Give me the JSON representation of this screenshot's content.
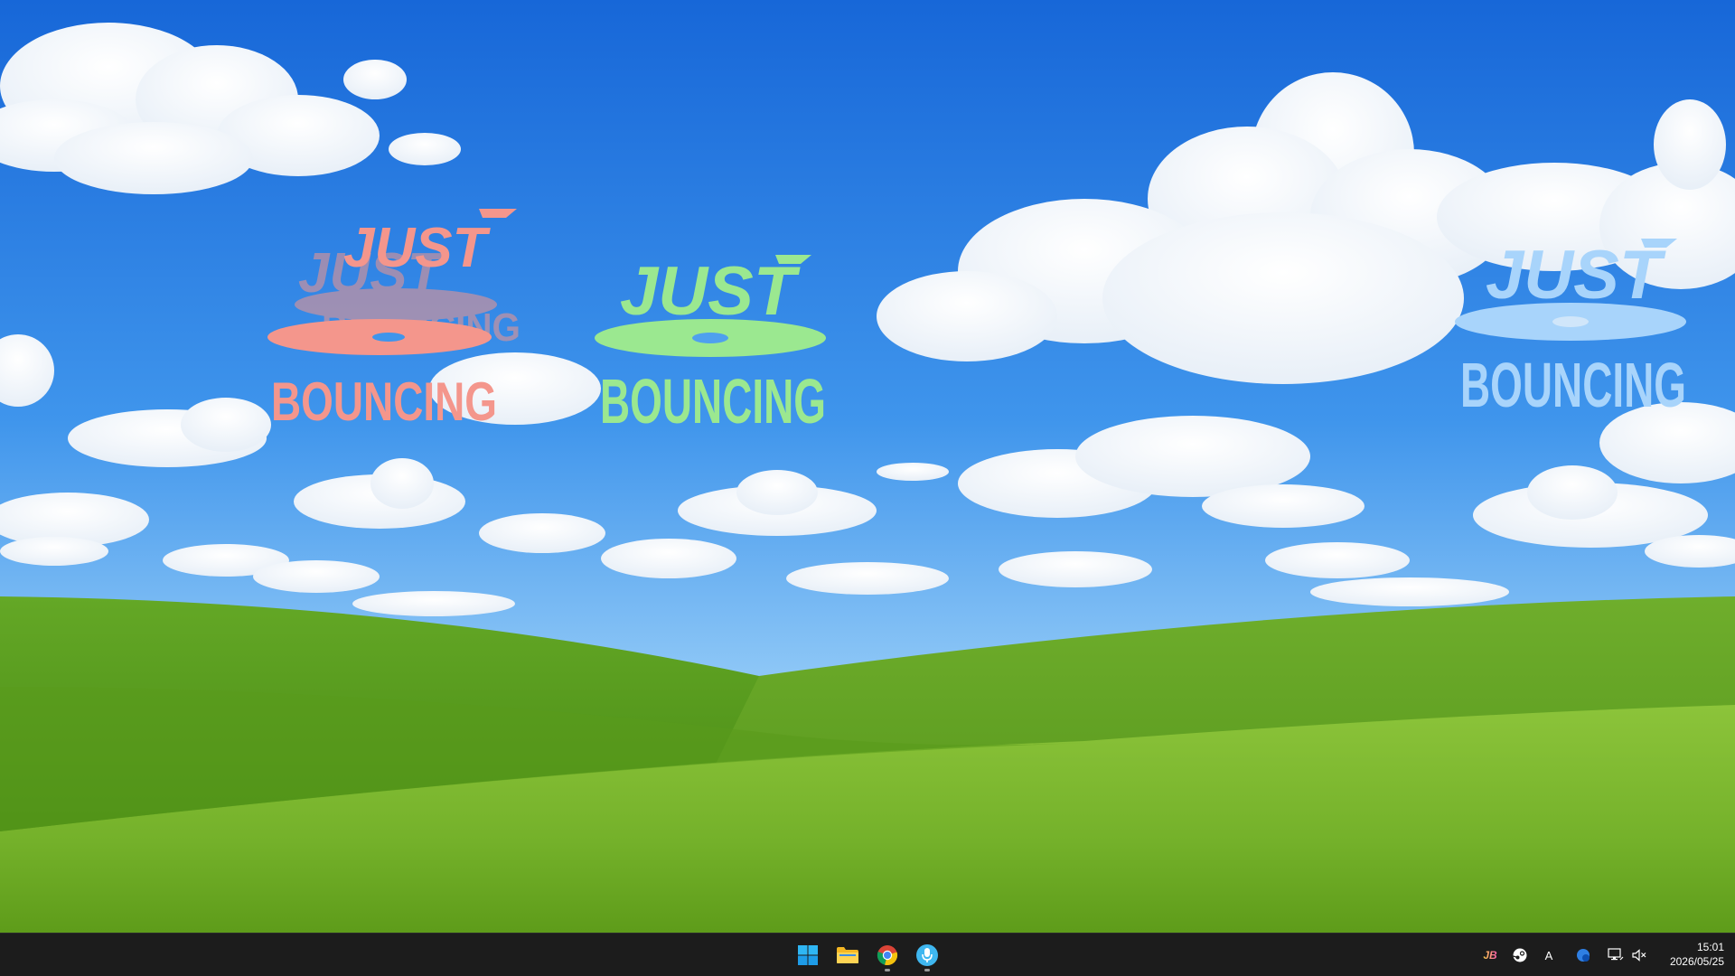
{
  "desktop": {
    "logos": [
      {
        "line1": "JUST",
        "line2": "BOUNCING",
        "color": "#f4968c",
        "style": "smeared"
      },
      {
        "line1": "JUST",
        "line2": "BOUNCING",
        "color": "#9be890",
        "style": "normal"
      },
      {
        "line1": "JUST",
        "line2": "BOUNCING",
        "color": "#a8d4fb",
        "style": "normal"
      }
    ]
  },
  "taskbar": {
    "apps": [
      {
        "name": "start-button",
        "icon": "windows-logo-icon"
      },
      {
        "name": "file-explorer",
        "icon": "folder-icon"
      },
      {
        "name": "chrome",
        "icon": "chrome-icon"
      },
      {
        "name": "speech-app",
        "icon": "microphone-icon"
      }
    ],
    "tray": {
      "app_badge_label": "JB",
      "ime_label": "A",
      "icons": [
        "jb-app-icon",
        "steam-icon",
        "ime-icon",
        "onedrive-icon",
        "network-icon",
        "volume-muted-icon"
      ]
    },
    "clock": {
      "time": "15:01",
      "date": "2026/05/25"
    }
  }
}
